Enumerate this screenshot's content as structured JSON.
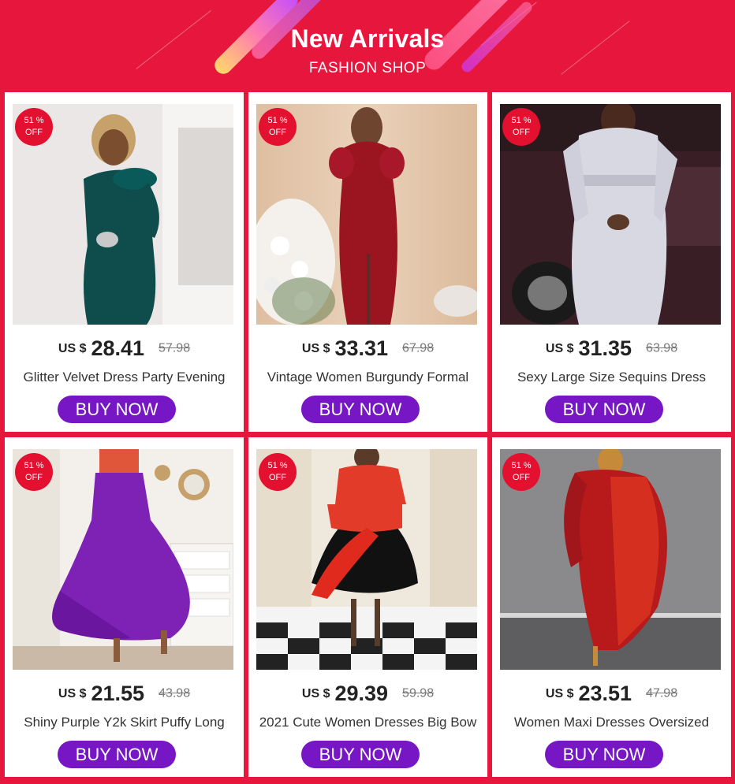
{
  "banner": {
    "title": "New Arrivals",
    "subtitle": "FASHION SHOP"
  },
  "colors": {
    "background": "#e6163d",
    "badge": "#e3102f",
    "button": "#7616c5"
  },
  "products": [
    {
      "badge_line1": "51 %",
      "badge_line2": "OFF",
      "currency": "US $",
      "price": "28.41",
      "old_price": "57.98",
      "title": "Glitter Velvet Dress Party Evening",
      "button": "BUY NOW",
      "image": "teal-velvet-dress-photo"
    },
    {
      "badge_line1": "51 %",
      "badge_line2": "OFF",
      "currency": "US $",
      "price": "33.31",
      "old_price": "67.98",
      "title": "Vintage Women Burgundy Formal",
      "button": "BUY NOW",
      "image": "burgundy-formal-dress-photo"
    },
    {
      "badge_line1": "51 %",
      "badge_line2": "OFF",
      "currency": "US $",
      "price": "31.35",
      "old_price": "63.98",
      "title": "Sexy Large Size Sequins Dress",
      "button": "BUY NOW",
      "image": "silver-sequin-dress-photo"
    },
    {
      "badge_line1": "51 %",
      "badge_line2": "OFF",
      "currency": "US $",
      "price": "21.55",
      "old_price": "43.98",
      "title": "Shiny Purple Y2k Skirt Puffy Long",
      "button": "BUY NOW",
      "image": "purple-skirt-photo"
    },
    {
      "badge_line1": "51 %",
      "badge_line2": "OFF",
      "currency": "US $",
      "price": "29.39",
      "old_price": "59.98",
      "title": "2021 Cute Women Dresses Big Bow",
      "button": "BUY NOW",
      "image": "red-black-bow-dress-photo"
    },
    {
      "badge_line1": "51 %",
      "badge_line2": "OFF",
      "currency": "US $",
      "price": "23.51",
      "old_price": "47.98",
      "title": "Women Maxi Dresses Oversized",
      "button": "BUY NOW",
      "image": "red-satin-maxi-dress-photo"
    }
  ]
}
